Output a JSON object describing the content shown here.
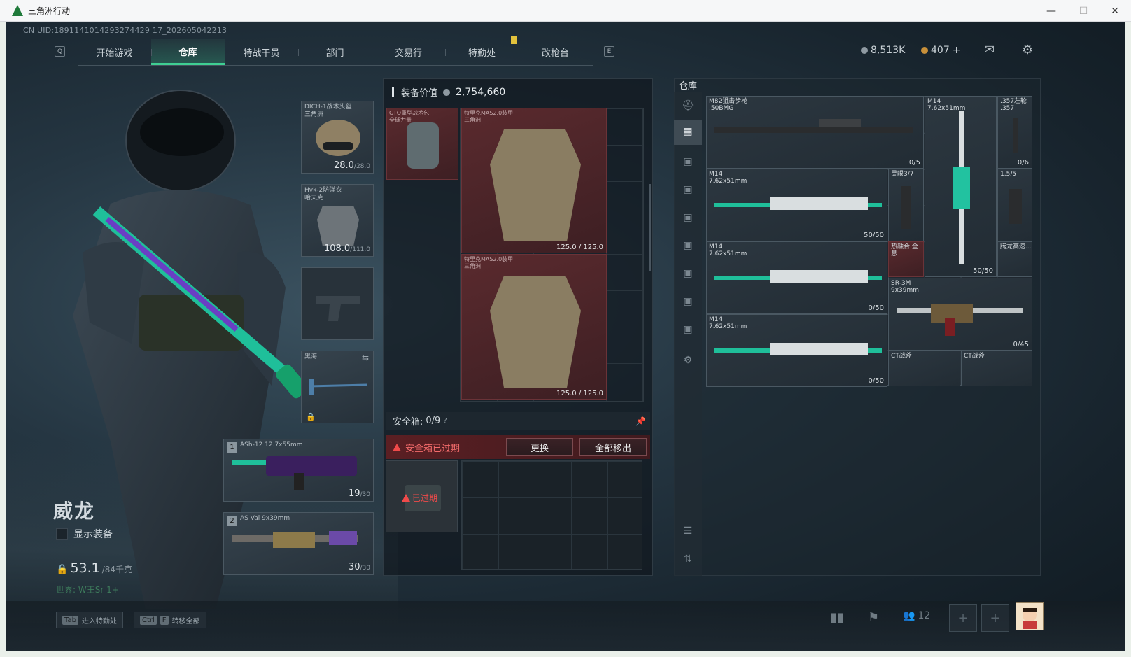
{
  "window": {
    "title": "三角洲行动",
    "minimize": "—",
    "maximize": "☐",
    "close": "✕"
  },
  "uid": "CN UID:1891141014293274429 17_202605042213",
  "nav": {
    "left_key": "Q",
    "right_key": "E",
    "tabs": [
      {
        "label": "开始游戏"
      },
      {
        "label": "仓库"
      },
      {
        "label": "特战干员"
      },
      {
        "label": "部门"
      },
      {
        "label": "交易行"
      },
      {
        "label": "特勤处"
      },
      {
        "label": "改枪台"
      }
    ],
    "badge": "!"
  },
  "currency": {
    "hafbucks": "8,513K",
    "coins": "407",
    "plus": "+"
  },
  "character": {
    "name": "威龙",
    "show_equipment": "显示装备",
    "weight": "53.1",
    "weight_max": "/84千克",
    "world": "世界: W王Sr  1+"
  },
  "loadout": {
    "helmet": {
      "label": "DICH-1战术头盔\n三角洲",
      "value": "28.0",
      "max": "/28.0"
    },
    "armor": {
      "label": "Hvk-2防弹衣\n哈夫克",
      "value": "108.0",
      "max": "/111.0"
    },
    "melee": {
      "label": "黑海"
    },
    "primary": {
      "slot": "1",
      "label": "ASh-12\n12.7x55mm",
      "value": "19",
      "max": "/30"
    },
    "secondary": {
      "slot": "2",
      "label": "AS Val\n9x39mm",
      "value": "30",
      "max": "/30"
    }
  },
  "equipment": {
    "title": "装备价值",
    "value": "2,754,660",
    "backpack": {
      "label": "GTO重型战术包\n全球力量"
    },
    "vest1": {
      "label": "特里克MAS2.0装甲\n三角洲",
      "value": "125.0 / 125.0"
    },
    "vest2": {
      "label": "特里克MAS2.0装甲\n三角洲",
      "value": "125.0 / 125.0"
    },
    "safebox": {
      "label": "安全箱:",
      "count": "0/9",
      "help": "?"
    },
    "expired": {
      "text": "安全箱已过期",
      "replace": "更换",
      "move_all": "全部移出",
      "badge": "已过期"
    }
  },
  "warehouse": {
    "title": "仓库",
    "items": [
      {
        "label": "M82狙击步枪\n.50BMG",
        "count": "0/5"
      },
      {
        "label": "M14\n7.62x51mm",
        "count": "50/50"
      },
      {
        "label": ".357左轮\n.357",
        "count": "0/6"
      },
      {
        "label": "M14\n7.62x51mm",
        "count": "50/50"
      },
      {
        "label": "灵眼3/7",
        "count": ""
      },
      {
        "label": "1.5/5",
        "count": ""
      },
      {
        "label": "M14\n7.62x51mm",
        "count": "0/50"
      },
      {
        "label": "热融合 全息",
        "count": ""
      },
      {
        "label": "腾龙高速...",
        "count": ""
      },
      {
        "label": "SR-3M\n9x39mm",
        "count": "0/45"
      },
      {
        "label": "M14\n7.62x51mm",
        "count": "0/50"
      },
      {
        "label": "CT战斧",
        "count": ""
      },
      {
        "label": "CT战斧",
        "count": ""
      }
    ]
  },
  "bottom": {
    "tab_hint": "进入特勤处",
    "tab_key": "Tab",
    "ctrl_key": "Ctrl",
    "f_key": "F",
    "transfer_hint": "转移全部",
    "players": "12"
  },
  "colors": {
    "accent": "#3fcf93",
    "danger": "#f04a4a",
    "red_slot": "#5a2a2e"
  }
}
